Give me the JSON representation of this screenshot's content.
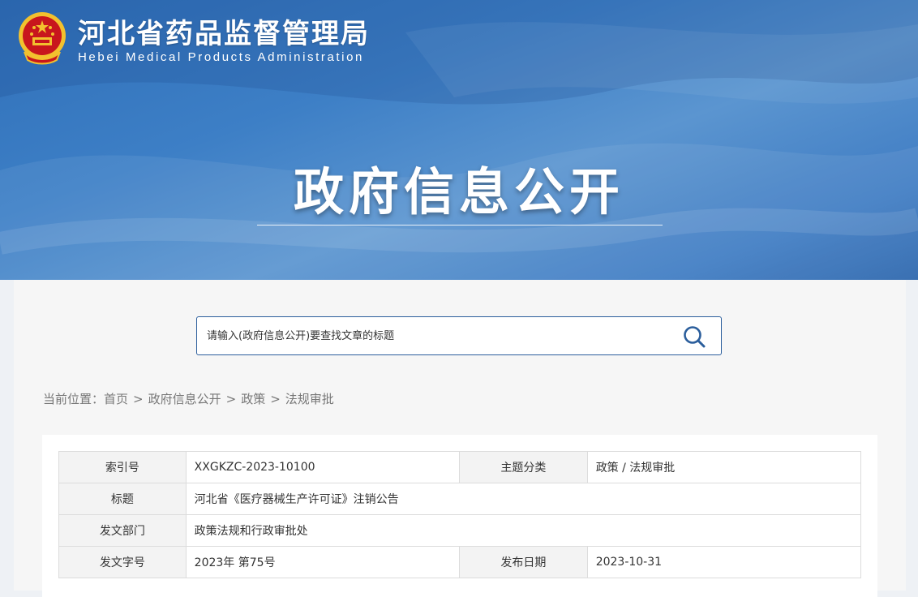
{
  "header": {
    "site_name": "河北省药品监督管理局",
    "site_name_en": "Hebei Medical Products Administration",
    "emblem_icon": "national-emblem-icon"
  },
  "hero": {
    "title": "政府信息公开"
  },
  "search": {
    "placeholder": "请输入(政府信息公开)要查找文章的标题",
    "icon": "search-icon"
  },
  "breadcrumb": {
    "prefix": "当前位置：",
    "items": [
      "首页",
      "政府信息公开",
      "政策",
      "法规审批"
    ],
    "separator": ">"
  },
  "meta": {
    "index_label": "索引号",
    "index_value": "XXGKZC-2023-10100",
    "topic_label": "主题分类",
    "topic_value": "政策 / 法规审批",
    "title_label": "标题",
    "title_value": "河北省《医疗器械生产许可证》注销公告",
    "dept_label": "发文部门",
    "dept_value": "政策法规和行政审批处",
    "docno_label": "发文字号",
    "docno_value": "2023年 第75号",
    "date_label": "发布日期",
    "date_value": "2023-10-31"
  },
  "colors": {
    "banner": "#3d7fc6",
    "search_border": "#2b5e9c",
    "emblem_red": "#c8161d",
    "emblem_gold": "#f2c12e"
  }
}
